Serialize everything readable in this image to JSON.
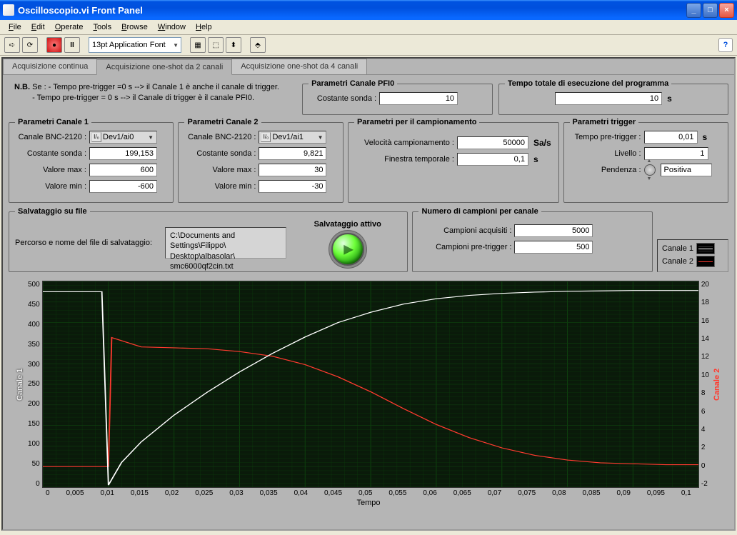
{
  "window_title": "Oscilloscopio.vi Front Panel",
  "menu": [
    "File",
    "Edit",
    "Operate",
    "Tools",
    "Browse",
    "Window",
    "Help"
  ],
  "toolbar_font": "13pt Application Font",
  "tabs": [
    {
      "label": "Acquisizione continua"
    },
    {
      "label": "Acquisizione one-shot da 2 canali"
    },
    {
      "label": "Acquisizione one-shot da 4 canali"
    }
  ],
  "active_tab": 1,
  "nb": {
    "prefix": "N.B.",
    "line1": "Se : - Tempo pre-trigger =0 s --> il Canale 1 è anche il canale di trigger.",
    "line2": "       - Tempo pre-trigger = 0 s --> il Canale di trigger è il canale PFI0."
  },
  "pfi0": {
    "legend": "Parametri Canale PFI0",
    "costante_label": "Costante sonda :",
    "costante_val": "10"
  },
  "tempo_totale": {
    "legend": "Tempo totale di esecuzione del programma",
    "val": "10",
    "unit": "s"
  },
  "canale1": {
    "legend": "Parametri Canale 1",
    "device_label": "Canale BNC-2120 :",
    "device_val": "Dev1/ai0",
    "costante_label": "Costante sonda :",
    "costante_val": "199,153",
    "vmax_label": "Valore max :",
    "vmax_val": "600",
    "vmin_label": "Valore min :",
    "vmin_val": "-600"
  },
  "canale2": {
    "legend": "Parametri Canale 2",
    "device_label": "Canale BNC-2120 :",
    "device_val": "Dev1/ai1",
    "costante_label": "Costante sonda :",
    "costante_val": "9,821",
    "vmax_label": "Valore max :",
    "vmax_val": "30",
    "vmin_label": "Valore min :",
    "vmin_val": "-30"
  },
  "campionamento": {
    "legend": "Parametri per il campionamento",
    "vel_label": "Velocità campionamento :",
    "vel_val": "50000",
    "vel_unit": "Sa/s",
    "fin_label": "Finestra temporale :",
    "fin_val": "0,1",
    "fin_unit": "s"
  },
  "trigger": {
    "legend": "Parametri trigger",
    "pre_label": "Tempo pre-trigger :",
    "pre_val": "0,01",
    "pre_unit": "s",
    "liv_label": "Livello :",
    "liv_val": "1",
    "pend_label": "Pendenza :",
    "pend_val": "Positiva"
  },
  "save": {
    "legend": "Salvataggio su file",
    "path_label": "Percorso e nome del file di salvataggio:",
    "path_val": "C:\\Documents and Settings\\Filippo\\\nDesktop\\albasolar\\\nsmc6000qf2cin.txt",
    "active_label": "Salvataggio attivo"
  },
  "campioni": {
    "legend": "Numero di campioni per canale",
    "acq_label": "Campioni acquisiti :",
    "acq_val": "5000",
    "pre_label": "Campioni pre-trigger :",
    "pre_val": "500"
  },
  "legend_items": [
    "Canale 1",
    "Canale 2"
  ],
  "chart": {
    "xlabel": "Tempo",
    "y1label": "Canale 1",
    "y2label": "Canale 2",
    "y1ticks": [
      "500",
      "450",
      "400",
      "350",
      "300",
      "250",
      "200",
      "150",
      "100",
      "50",
      "0"
    ],
    "y2ticks": [
      "20",
      "18",
      "16",
      "14",
      "12",
      "10",
      "8",
      "6",
      "4",
      "2",
      "0",
      "-2"
    ],
    "xticks": [
      "0",
      "0,005",
      "0,01",
      "0,015",
      "0,02",
      "0,025",
      "0,03",
      "0,035",
      "0,04",
      "0,045",
      "0,05",
      "0,055",
      "0,06",
      "0,065",
      "0,07",
      "0,075",
      "0,08",
      "0,085",
      "0,09",
      "0,095",
      "0,1"
    ]
  },
  "chart_data": {
    "type": "line",
    "title": "",
    "xlabel": "Tempo",
    "xlim": [
      0,
      0.1
    ],
    "series": [
      {
        "name": "Canale 1",
        "ylabel": "Canale 1",
        "ylim": [
          0,
          500
        ],
        "color": "#ffffff",
        "x": [
          0,
          0.009,
          0.01,
          0.012,
          0.015,
          0.02,
          0.025,
          0.03,
          0.035,
          0.04,
          0.045,
          0.05,
          0.055,
          0.06,
          0.065,
          0.07,
          0.075,
          0.08,
          0.085,
          0.09,
          0.095,
          0.1
        ],
        "values": [
          475,
          475,
          5,
          60,
          110,
          175,
          230,
          280,
          325,
          365,
          400,
          425,
          445,
          458,
          466,
          471,
          474,
          476,
          477,
          478,
          478,
          478
        ]
      },
      {
        "name": "Canale 2",
        "ylabel": "Canale 2",
        "ylim": [
          -2,
          20
        ],
        "color": "#ff3a2f",
        "x": [
          0,
          0.009,
          0.01,
          0.0105,
          0.015,
          0.02,
          0.025,
          0.03,
          0.035,
          0.04,
          0.045,
          0.05,
          0.055,
          0.06,
          0.065,
          0.07,
          0.075,
          0.08,
          0.085,
          0.09,
          0.095,
          0.1
        ],
        "values": [
          0.2,
          0.2,
          0.2,
          14,
          13,
          12.9,
          12.8,
          12.5,
          12,
          11.1,
          9.8,
          8.2,
          6.4,
          4.7,
          3.3,
          2.2,
          1.4,
          0.9,
          0.6,
          0.5,
          0.4,
          0.4
        ]
      }
    ]
  }
}
